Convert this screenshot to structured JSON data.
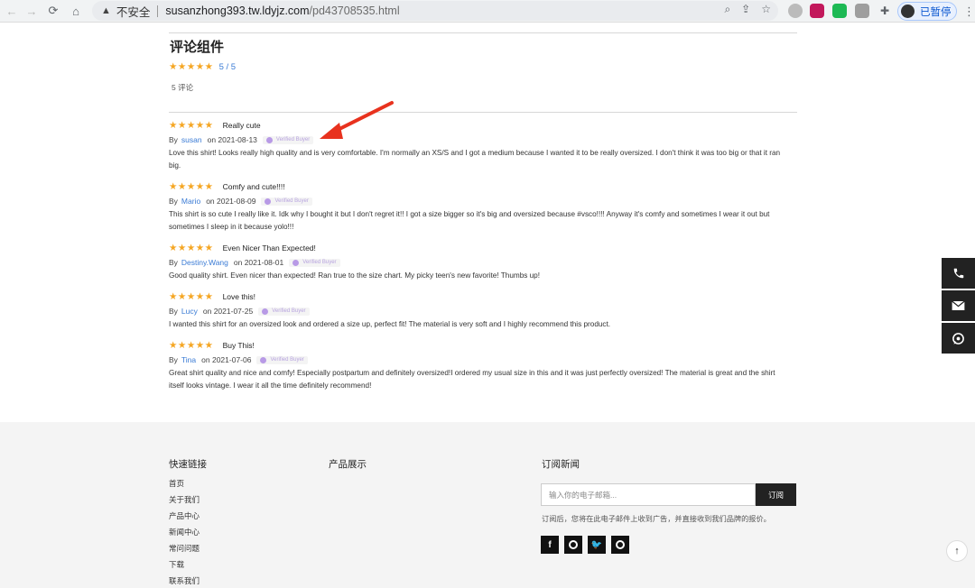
{
  "browser": {
    "insecure_label": "不安全",
    "url_host": "susanzhong393.tw.ldyjz.com",
    "url_path": "/pd43708535.html",
    "profile_label": "已暂停",
    "nav_back_icon": "arrow-left-icon",
    "nav_forward_icon": "arrow-right-icon",
    "reload_icon": "reload-icon",
    "home_icon": "home-icon"
  },
  "reviews_section": {
    "title": "评论组件",
    "summary_stars": "★★★★★",
    "summary_score": "5 / 5",
    "count_label": "5  评论"
  },
  "reviews": [
    {
      "stars": "★★★★★",
      "headline": "Really cute",
      "by": "By",
      "author": "susan",
      "date": "on 2021-08-13",
      "verified": "Verified Buyer",
      "body": "Love this shirt! Looks really high quality and is very comfortable. I'm normally an XS/S and I got a medium because I wanted it to be really oversized. I don't think it was too big or that it ran big."
    },
    {
      "stars": "★★★★★",
      "headline": "Comfy and cute!!!!",
      "by": "By",
      "author": "Mario",
      "date": "on 2021-08-09",
      "verified": "Verified Buyer",
      "body": "This shirt is so cute I really like it. Idk why I bought it but I don't regret it!! I got a size bigger so it's big and oversized because #vsco!!!! Anyway it's comfy and sometimes I wear it out but sometimes I sleep in it because yolo!!!"
    },
    {
      "stars": "★★★★★",
      "headline": "Even Nicer Than Expected!",
      "by": "By",
      "author": "Destiny.Wang",
      "date": "on 2021-08-01",
      "verified": "Verified Buyer",
      "body": "Good quality shirt. Even nicer than expected! Ran true to the size chart. My picky teen's new favorite! Thumbs up!"
    },
    {
      "stars": "★★★★★",
      "headline": "Love this!",
      "by": "By",
      "author": "Lucy",
      "date": "on 2021-07-25",
      "verified": "Verified Buyer",
      "body": "I wanted this shirt for an oversized look and ordered a size up, perfect fit! The material is very soft and I highly recommend this product."
    },
    {
      "stars": "★★★★★",
      "headline": "Buy This!",
      "by": "By",
      "author": "Tina",
      "date": "on 2021-07-06",
      "verified": "Verified Buyer",
      "body": "Great shirt quality and nice and comfy! Especially postpartum and definitely oversized!I ordered my usual size in this and it was just perfectly oversized! The material is great and the shirt itself looks vintage. I wear it all the time definitely recommend!"
    }
  ],
  "footer": {
    "quick_links_title": "快速链接",
    "quick_links": [
      "首页",
      "关于我们",
      "产品中心",
      "新闻中心",
      "常问问题",
      "下载",
      "联系我们"
    ],
    "products_title": "产品展示",
    "newsletter_title": "订阅新闻",
    "newsletter_placeholder": "输入你的电子邮箱...",
    "subscribe_label": "订阅",
    "newsletter_note": "订阅后，您将在此电子邮件上收到广告，并直接收到我们品牌的报价。",
    "social_icons": [
      "facebook-icon",
      "linkedin-icon",
      "twitter-icon",
      "youtube-icon"
    ]
  },
  "colors": {
    "star": "#f5a623",
    "link": "#3a7bd5",
    "arrow": "#e8321e",
    "side_bar": "#222222"
  }
}
